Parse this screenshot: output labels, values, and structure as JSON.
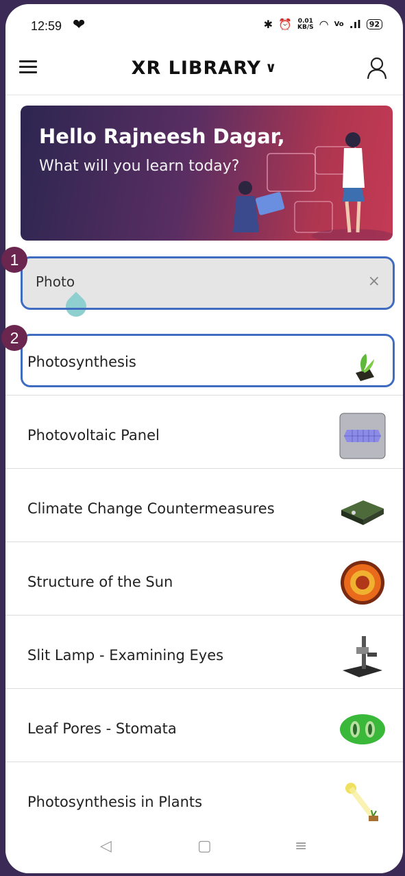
{
  "status": {
    "time": "12:59",
    "heart": "❤",
    "bluetooth": "✱",
    "alarm": "⏰",
    "speed_top": "0.01",
    "speed_unit": "KB/S",
    "wifi": "◠",
    "volte": "Vo",
    "signal": ".ıl",
    "battery": "92"
  },
  "header": {
    "title": "XR LIBRARY",
    "chevron": "∨",
    "menu_icon": "hamburger-icon",
    "user_icon": "user-icon"
  },
  "banner": {
    "greeting": "Hello Rajneesh Dagar,",
    "subtitle": "What will you learn today?"
  },
  "search": {
    "value": "Photo",
    "clear": "×"
  },
  "annotations": [
    "1",
    "2"
  ],
  "results": [
    {
      "label": "Photosynthesis",
      "icon": "plant-sprout-icon"
    },
    {
      "label": "Photovoltaic Panel",
      "icon": "solar-panel-icon"
    },
    {
      "label": "Climate Change Countermeasures",
      "icon": "terrain-model-icon"
    },
    {
      "label": "Structure of the Sun",
      "icon": "sun-layers-icon"
    },
    {
      "label": "Slit Lamp - Examining Eyes",
      "icon": "slit-lamp-icon"
    },
    {
      "label": "Leaf Pores - Stomata",
      "icon": "stomata-icon"
    },
    {
      "label": "Photosynthesis in Plants",
      "icon": "light-plant-icon"
    }
  ],
  "navbar": {
    "back": "◁",
    "home": "▢",
    "recents": "≡"
  },
  "colors": {
    "highlight": "#3f6cc0",
    "badge": "#6b2650"
  }
}
